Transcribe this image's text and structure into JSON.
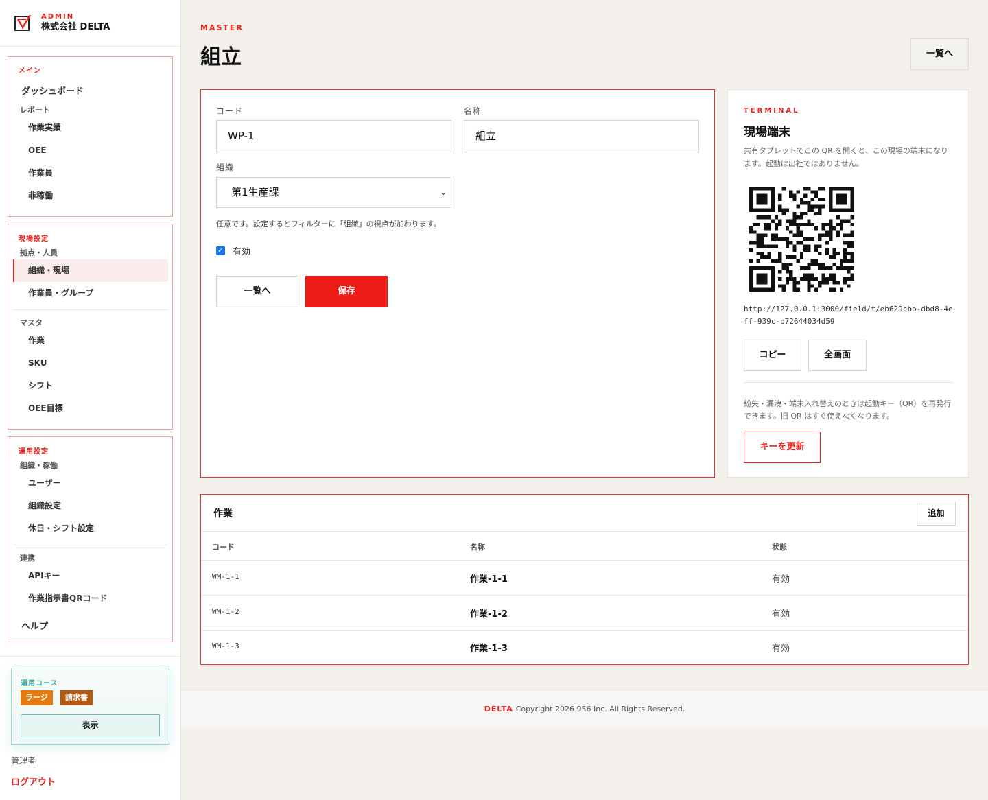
{
  "brand": {
    "admin": "ADMIN",
    "company": "株式会社 DELTA"
  },
  "sidebar": {
    "main": {
      "head": "メイン",
      "dashboard": "ダッシュボード",
      "report": "レポート",
      "items": [
        "作業実績",
        "OEE",
        "作業員",
        "非稼働"
      ]
    },
    "site": {
      "head": "現場設定",
      "group1": "拠点・人員",
      "items1": [
        "組織・現場",
        "作業員・グループ"
      ],
      "group2": "マスタ",
      "items2": [
        "作業",
        "SKU",
        "シフト",
        "OEE目標"
      ]
    },
    "ops": {
      "head": "運用設定",
      "group1": "組織・稼働",
      "items1": [
        "ユーザー",
        "組織設定",
        "休日・シフト設定"
      ],
      "group2": "連携",
      "items2": [
        "APIキー",
        "作業指示書QRコード"
      ],
      "help": "ヘルプ"
    },
    "course": {
      "title": "運用コース",
      "badge_large": "ラージ",
      "badge_invoice": "請求書",
      "show": "表示"
    },
    "user": "管理者",
    "logout": "ログアウト"
  },
  "header": {
    "label": "MASTER",
    "title": "組立",
    "back": "一覧へ"
  },
  "form": {
    "code_label": "コード",
    "code_value": "WP-1",
    "name_label": "名称",
    "name_value": "組立",
    "org_label": "組織",
    "org_value": "第1生産課",
    "hint": "任意です。設定するとフィルターに「組織」の視点が加わります。",
    "active_label": "有効",
    "back": "一覧へ",
    "save": "保存"
  },
  "terminal": {
    "label": "TERMINAL",
    "title": "現場端末",
    "desc": "共有タブレットでこの QR を開くと、この現場の端末になります。起動は出社ではありません。",
    "url": "http://127.0.0.1:3000/field/t/eb629cbb-dbd8-4eff-939c-b72644034d59",
    "copy": "コピー",
    "fullscreen": "全画面",
    "note": "紛失・漏洩・端末入れ替えのときは起動キー（QR）を再発行できます。旧 QR はすぐ使えなくなります。",
    "rekey": "キーを更新"
  },
  "operations": {
    "title": "作業",
    "add": "追加",
    "columns": [
      "コード",
      "名称",
      "状態"
    ],
    "rows": [
      {
        "code": "WM-1-1",
        "name": "作業-1-1",
        "status": "有効"
      },
      {
        "code": "WM-1-2",
        "name": "作業-1-2",
        "status": "有効"
      },
      {
        "code": "WM-1-3",
        "name": "作業-1-3",
        "status": "有効"
      }
    ]
  },
  "footer": {
    "brand": "DELTA",
    "copyright": "Copyright 2026 956 Inc. All Rights Reserved."
  },
  "colors": {
    "accent": "#e8201c",
    "teal": "#3aa99b"
  }
}
